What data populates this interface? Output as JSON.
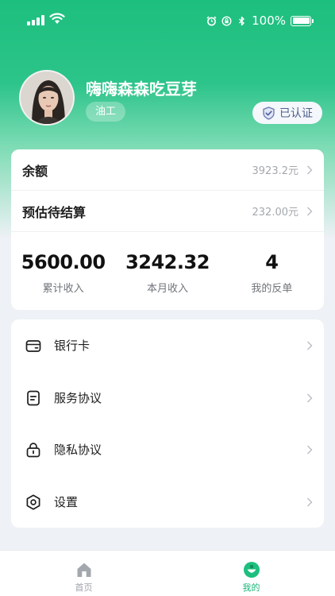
{
  "status_bar": {
    "battery": "100%"
  },
  "profile": {
    "nickname": "嗨嗨森森吃豆芽",
    "role": "油工",
    "verified_label": "已认证"
  },
  "balance": {
    "rows": [
      {
        "label": "余额",
        "value": "3923.2元"
      },
      {
        "label": "预估待结算",
        "value": "232.00元"
      }
    ],
    "stats": [
      {
        "value": "5600.00",
        "caption": "累计收入"
      },
      {
        "value": "3242.32",
        "caption": "本月收入"
      },
      {
        "value": "4",
        "caption": "我的反单"
      }
    ]
  },
  "menu": {
    "items": [
      {
        "label": "银行卡",
        "icon": "wallet-icon"
      },
      {
        "label": "服务协议",
        "icon": "document-icon"
      },
      {
        "label": "隐私协议",
        "icon": "lock-icon"
      },
      {
        "label": "设置",
        "icon": "settings-hexagon-icon"
      }
    ]
  },
  "tab_bar": {
    "tabs": [
      {
        "label": "首页",
        "icon": "home-icon",
        "active": false
      },
      {
        "label": "我的",
        "icon": "profile-icon",
        "active": true
      }
    ]
  },
  "colors": {
    "brand_green": "#1dbf7e",
    "inactive_tab": "#9ea3a9",
    "value_gray": "#a4a8ae"
  }
}
